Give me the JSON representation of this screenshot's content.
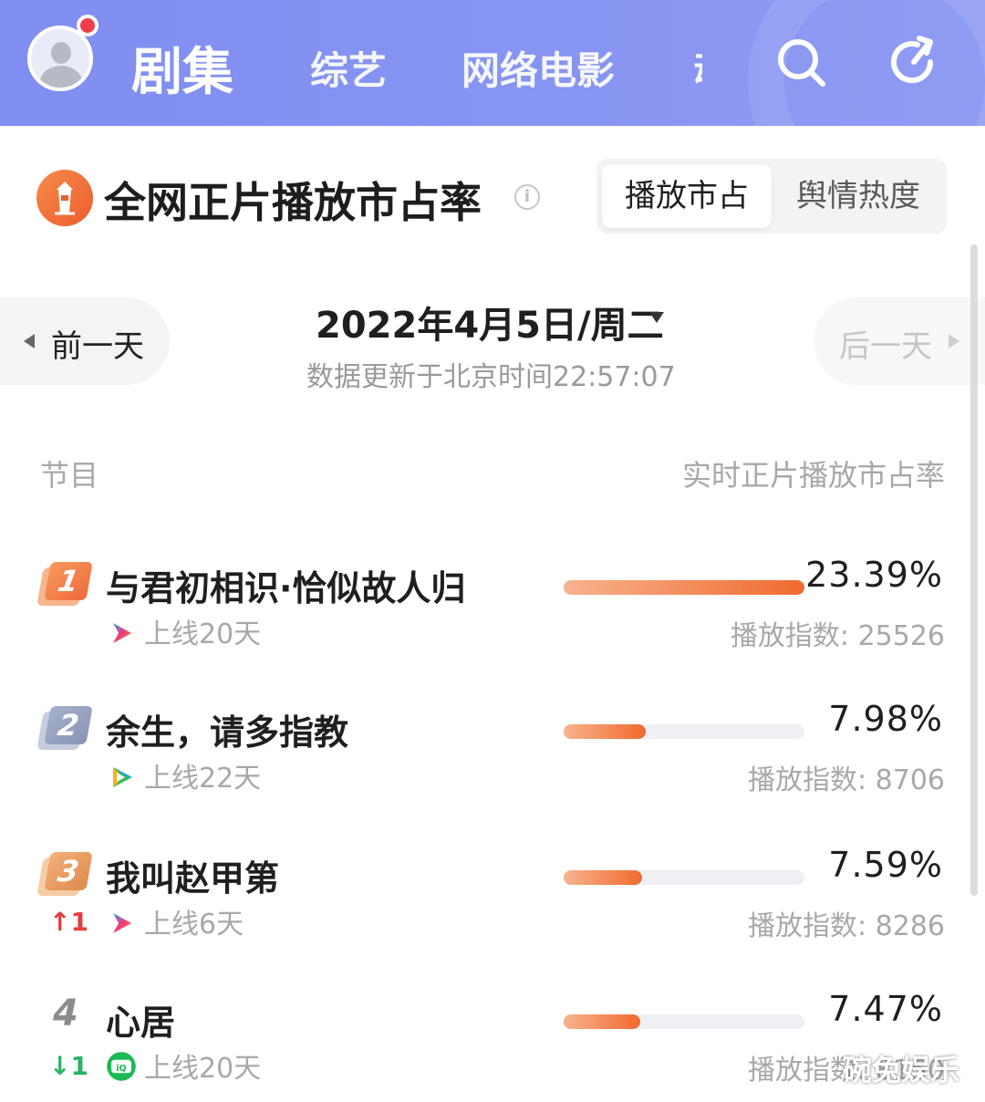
{
  "nav": {
    "tabs": [
      {
        "label": "剧集",
        "active": true
      },
      {
        "label": "综艺"
      },
      {
        "label": "网络电影"
      },
      {
        "label": "动"
      }
    ]
  },
  "header": {
    "title": "全网正片播放市占率",
    "info_icon": "i",
    "toggle": {
      "active": "播放市占",
      "inactive": "舆情热度"
    }
  },
  "date_nav": {
    "prev": "前一天",
    "next": "后一天",
    "date": "2022年4月5日/周二",
    "update": "数据更新于北京时间22:57:07"
  },
  "columns": {
    "left": "节目",
    "right": "实时正片播放市占率"
  },
  "rows": [
    {
      "rank": "1",
      "title": "与君初相识·恰似故人归",
      "platform": "youku",
      "online": "上线20天",
      "change": "",
      "share_pct": 23.39,
      "share": "23.39%",
      "index": "播放指数: 25526",
      "badge": "gold"
    },
    {
      "rank": "2",
      "title": "余生，请多指教",
      "platform": "tencent",
      "online": "上线22天",
      "change": "",
      "share_pct": 7.98,
      "share": "7.98%",
      "index": "播放指数: 8706",
      "badge": "silver"
    },
    {
      "rank": "3",
      "title": "我叫赵甲第",
      "platform": "youku",
      "online": "上线6天",
      "change": "↑1",
      "share_pct": 7.59,
      "share": "7.59%",
      "index": "播放指数: 8286",
      "badge": "bronze"
    },
    {
      "rank": "4",
      "title": "心居",
      "platform": "iqiyi",
      "online": "上线20天",
      "change": "↓1",
      "share_pct": 7.47,
      "share": "7.47%",
      "index": "播放指数: 8150",
      "badge": "plain"
    }
  ],
  "watermark": "碗兔娱乐",
  "colors": {
    "nav_bg": "#8492f2",
    "accent": "#f06a2e",
    "up": "#e53d3d",
    "down": "#2ab36a"
  }
}
